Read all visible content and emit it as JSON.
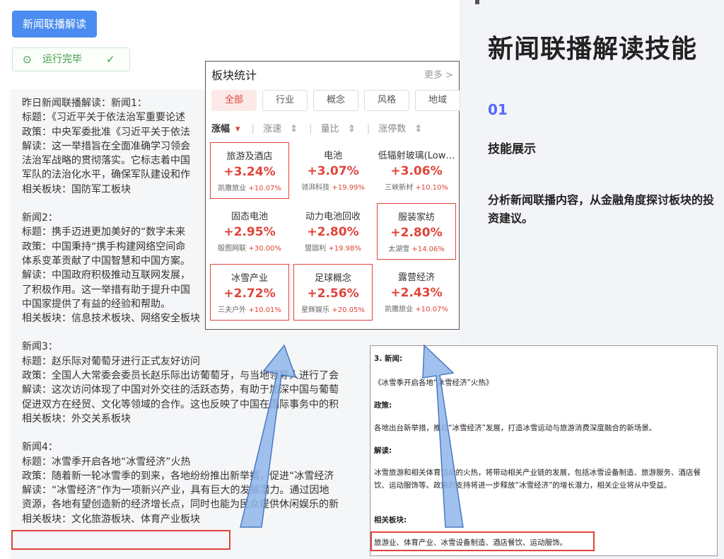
{
  "left": {
    "run_button": "新闻联播解读",
    "status_label": "运行完毕",
    "news_lines": [
      "昨日新闻联播解读：新闻1：",
      "标题：《习近平关于依法治军重要论述",
      "政策：中央军委批准《习近平关于依法",
      "解读：这一举措旨在全面准确学习领会",
      "法治军战略的贯彻落实。它标志着中国",
      "军队的法治化水平，确保军队建设和作",
      "相关板块：国防军工板块",
      "",
      "新闻2：",
      "标题：携手迈进更加美好的“数字未来",
      "政策：中国秉持“携手构建网络空间命",
      "体系变革贡献了中国智慧和中国方案。",
      "解读：中国政府积极推动互联网发展，",
      "了积极作用。这一举措有助于提升中国",
      "中国家提供了有益的经验和帮助。",
      "相关板块：信息技术板块、网络安全板块",
      "",
      "新闻3：",
      "标题：赵乐际对葡萄牙进行正式友好访问",
      "政策：全国人大常委会委员长赵乐际出访葡萄牙，与当地领导人进行了会",
      "解读：这次访问体现了中国对外交往的活跃态势，有助于加深中国与葡萄",
      "促进双方在经贸、文化等领域的合作。这也反映了中国在国际事务中的积",
      "相关板块：外交关系板块",
      "",
      "新闻4：",
      "标题：冰雪季开启各地“冰雪经济”火热",
      "政策：随着新一轮冰雪季的到来，各地纷纷推出新举措，促进“冰雪经济",
      "解读：“冰雪经济”作为一项新兴产业，具有巨大的发展潜力。通过因地",
      "资源，各地有望创造新的经济增长点，同时也能为民众提供休闲娱乐的新",
      "相关板块：文化旅游板块、体育产业板块"
    ]
  },
  "right": {
    "title": "新闻联播解读技能",
    "section_num": "01",
    "section_title": "技能展示",
    "description": "分析新闻联播内容，从金融角度探讨板块的投资建议。"
  },
  "panel": {
    "title": "板块统计",
    "more": "更多 >",
    "tabs": [
      "全部",
      "行业",
      "概念",
      "风格",
      "地域"
    ],
    "sorts": [
      "涨幅",
      "涨速",
      "量比",
      "涨停数"
    ],
    "cells": [
      {
        "name": "旅游及酒店",
        "pct": "+3.24%",
        "stock": "凯撒旅业",
        "stock_pct": "+10.07%"
      },
      {
        "name": "电池",
        "pct": "+3.07%",
        "stock": "领湃科技",
        "stock_pct": "+19.99%"
      },
      {
        "name": "低辐射玻璃(Low…",
        "pct": "+3.06%",
        "stock": "三峡新材",
        "stock_pct": "+10.10%"
      },
      {
        "name": "固态电池",
        "pct": "+2.95%",
        "stock": "殷图网联",
        "stock_pct": "+30.00%"
      },
      {
        "name": "动力电池回收",
        "pct": "+2.80%",
        "stock": "盟固利",
        "stock_pct": "+19.98%"
      },
      {
        "name": "服装家纺",
        "pct": "+2.80%",
        "stock": "太湖雪",
        "stock_pct": "+14.06%"
      },
      {
        "name": "冰雪产业",
        "pct": "+2.72%",
        "stock": "三夫户外",
        "stock_pct": "+10.01%"
      },
      {
        "name": "足球概念",
        "pct": "+2.56%",
        "stock": "星辉娱乐",
        "stock_pct": "+20.05%"
      },
      {
        "name": "露营经济",
        "pct": "+2.43%",
        "stock": "凯撒旅业",
        "stock_pct": "+10.07%"
      }
    ]
  },
  "card": {
    "head": "3. 新闻:",
    "title": "《冰雪季开启各地“冰雪经济”火热》",
    "policy_label": "政策:",
    "policy": "各地出台新举措，推动“冰雪经济”发展，打造冰雪运动与旅游消费深度融合的新场景。",
    "interp_label": "解读:",
    "interp": "冰雪旅游和相关体育活动的火热，将带动相关产业链的发展，包括冰雪设备制造、旅游服务、酒店餐饮、运动服饰等。政策的支持将进一步释放“冰雪经济”的增长潜力，相关企业将从中受益。",
    "sector_label": "相关板块:",
    "sectors": "旅游业、体育产业、冰雪设备制造、酒店餐饮、运动服饰。"
  }
}
